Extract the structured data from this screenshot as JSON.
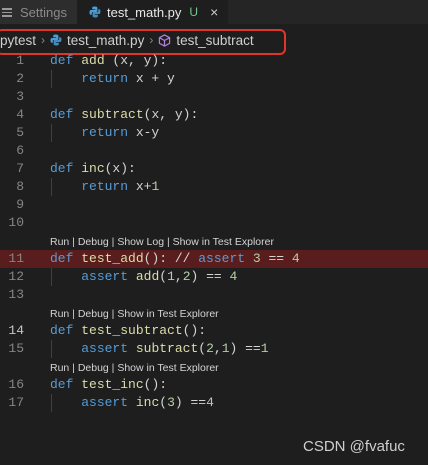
{
  "tabs": [
    {
      "label": "Settings",
      "icon": "settings-list-icon"
    },
    {
      "label": "test_math.py",
      "icon": "python-icon",
      "status": "U",
      "close": "×"
    }
  ],
  "breadcrumb": {
    "items": [
      "pytest",
      "test_math.py",
      "test_subtract"
    ],
    "separator": "›",
    "icons": [
      "",
      "python-icon",
      "method-cube-icon"
    ]
  },
  "editor": {
    "lines": [
      {
        "n": "1",
        "code": "def add (x, y):"
      },
      {
        "n": "2",
        "code": "    return x + y"
      },
      {
        "n": "3",
        "code": ""
      },
      {
        "n": "4",
        "code": "def subtract(x, y):"
      },
      {
        "n": "5",
        "code": "    return x-y"
      },
      {
        "n": "6",
        "code": ""
      },
      {
        "n": "7",
        "code": "def inc(x):"
      },
      {
        "n": "8",
        "code": "    return x+1"
      },
      {
        "n": "9",
        "code": ""
      },
      {
        "n": "10",
        "code": ""
      },
      {
        "lens": "Run | Debug | Show Log | Show in Test Explorer"
      },
      {
        "n": "11",
        "code": "def test_add(): // assert 3 == 4",
        "error": true
      },
      {
        "n": "12",
        "code": "    assert add(1,2) == 4"
      },
      {
        "n": "13",
        "code": ""
      },
      {
        "lens": "Run | Debug | Show in Test Explorer"
      },
      {
        "n": "14",
        "code": "def test_subtract():",
        "current": true
      },
      {
        "n": "15",
        "code": "    assert subtract(2,1) ==1"
      },
      {
        "lens": "Run | Debug | Show in Test Explorer"
      },
      {
        "n": "16",
        "code": "def test_inc():"
      },
      {
        "n": "17",
        "code": "    assert inc(3) ==4"
      }
    ]
  },
  "watermark": "CSDN @fvafuc",
  "colors": {
    "background": "#1e1e1e",
    "keyword": "#569cd6",
    "function": "#dcdcaa",
    "number": "#b5cea8",
    "error_line": "#5a1d1d",
    "highlight_outline": "#e0352a",
    "untracked": "#73c991"
  }
}
